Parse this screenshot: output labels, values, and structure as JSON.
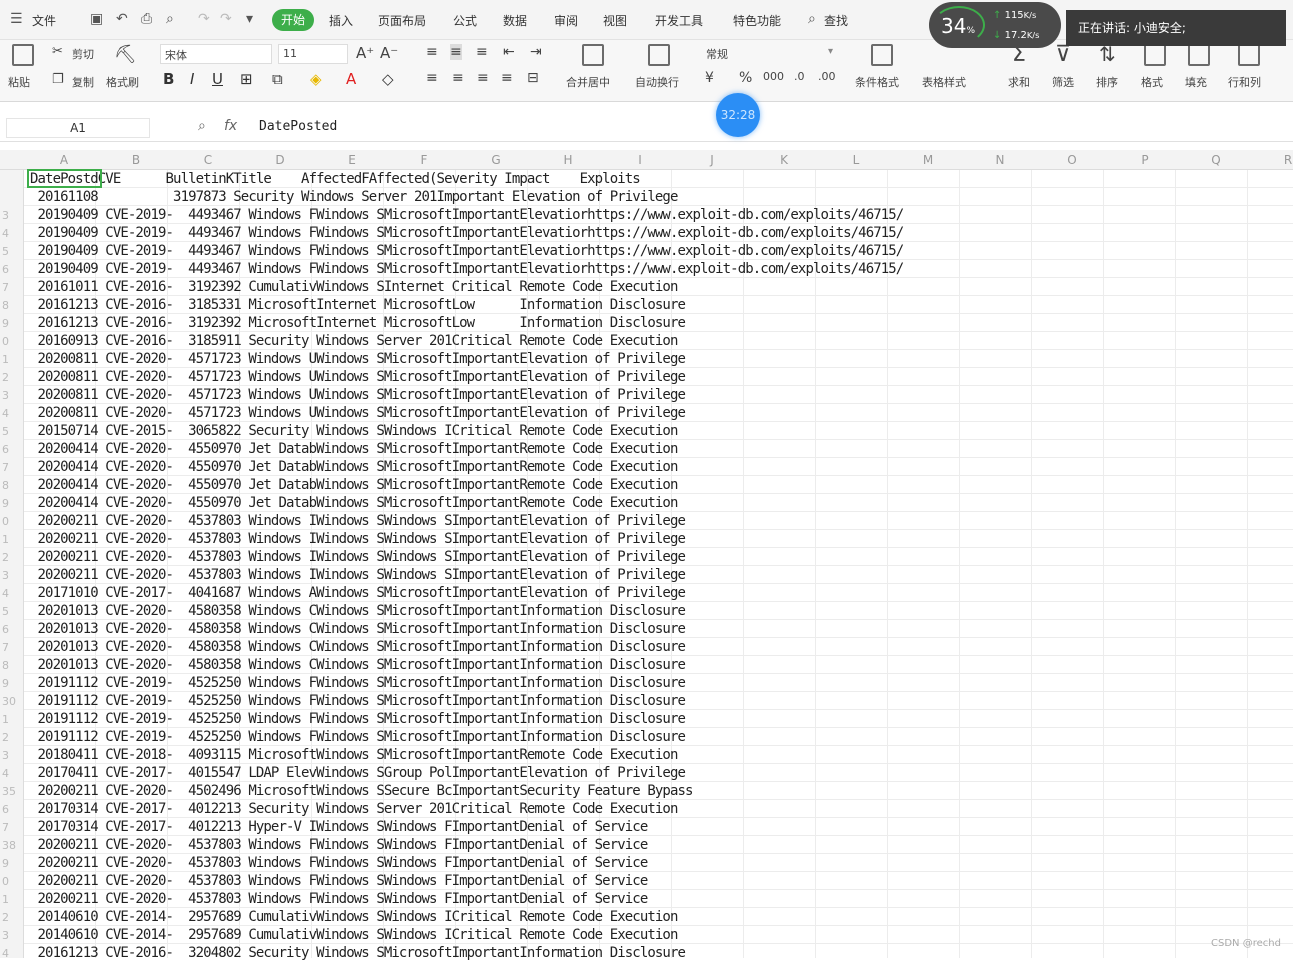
{
  "menubar": {
    "file": "文件",
    "tabs": [
      "开始",
      "插入",
      "页面布局",
      "公式",
      "数据",
      "审阅",
      "视图",
      "开发工具",
      "特色功能"
    ],
    "search": "查找"
  },
  "ribbon": {
    "paste": "粘贴",
    "cut": "剪切",
    "copy": "复制",
    "format_painter": "格式刷",
    "font_name": "宋体",
    "font_size": "11",
    "merge_center": "合并居中",
    "wrap": "自动换行",
    "number_format": "常规",
    "conditional_format": "条件格式",
    "table_style": "表格样式",
    "sum": "求和",
    "filter": "筛选",
    "sort": "排序",
    "format": "格式",
    "fill": "填充",
    "row_col": "行和列"
  },
  "overlay": {
    "cpu_pct": "34",
    "up_speed": "115",
    "down_speed": "17.2",
    "speaking": "正在讲话: 小迪安全;",
    "timer": "32:28"
  },
  "formula_bar": {
    "name_box": "A1",
    "content": "DatePosted"
  },
  "columns": [
    "A",
    "B",
    "C",
    "D",
    "E",
    "F",
    "G",
    "H",
    "I",
    "J",
    "K",
    "L",
    "M",
    "N",
    "O",
    "P",
    "Q",
    "R"
  ],
  "rows": [
    {
      "n": "",
      "text": "DatePostdCVE      BulletinKTitle    AffectedFAffected(Severity Impact    Exploits"
    },
    {
      "n": "",
      "text": " 20161108          3197873 Security Windows Server 201Important Elevation of Privilege"
    },
    {
      "n": "3",
      "text": " 20190409 CVE-2019-  4493467 Windows FWindows SMicrosoftImportantElevatiorhttps://www.exploit-db.com/exploits/46715/"
    },
    {
      "n": "4",
      "text": " 20190409 CVE-2019-  4493467 Windows FWindows SMicrosoftImportantElevatiorhttps://www.exploit-db.com/exploits/46715/"
    },
    {
      "n": "5",
      "text": " 20190409 CVE-2019-  4493467 Windows FWindows SMicrosoftImportantElevatiorhttps://www.exploit-db.com/exploits/46715/"
    },
    {
      "n": "6",
      "text": " 20190409 CVE-2019-  4493467 Windows FWindows SMicrosoftImportantElevatiorhttps://www.exploit-db.com/exploits/46715/"
    },
    {
      "n": "7",
      "text": " 20161011 CVE-2016-  3192392 CumulativWindows SInternet Critical Remote Code Execution"
    },
    {
      "n": "8",
      "text": " 20161213 CVE-2016-  3185331 MicrosoftInternet MicrosoftLow      Information Disclosure"
    },
    {
      "n": "9",
      "text": " 20161213 CVE-2016-  3192392 MicrosoftInternet MicrosoftLow      Information Disclosure"
    },
    {
      "n": "0",
      "text": " 20160913 CVE-2016-  3185911 Security Windows Server 201Critical Remote Code Execution"
    },
    {
      "n": "1",
      "text": " 20200811 CVE-2020-  4571723 Windows UWindows SMicrosoftImportantElevation of Privilege"
    },
    {
      "n": "2",
      "text": " 20200811 CVE-2020-  4571723 Windows UWindows SMicrosoftImportantElevation of Privilege"
    },
    {
      "n": "3",
      "text": " 20200811 CVE-2020-  4571723 Windows UWindows SMicrosoftImportantElevation of Privilege"
    },
    {
      "n": "4",
      "text": " 20200811 CVE-2020-  4571723 Windows UWindows SMicrosoftImportantElevation of Privilege"
    },
    {
      "n": "5",
      "text": " 20150714 CVE-2015-  3065822 Security Windows SWindows ICritical Remote Code Execution"
    },
    {
      "n": "6",
      "text": " 20200414 CVE-2020-  4550970 Jet DatabWindows SMicrosoftImportantRemote Code Execution"
    },
    {
      "n": "7",
      "text": " 20200414 CVE-2020-  4550970 Jet DatabWindows SMicrosoftImportantRemote Code Execution"
    },
    {
      "n": "8",
      "text": " 20200414 CVE-2020-  4550970 Jet DatabWindows SMicrosoftImportantRemote Code Execution"
    },
    {
      "n": "9",
      "text": " 20200414 CVE-2020-  4550970 Jet DatabWindows SMicrosoftImportantRemote Code Execution"
    },
    {
      "n": "0",
      "text": " 20200211 CVE-2020-  4537803 Windows IWindows SWindows SImportantElevation of Privilege"
    },
    {
      "n": "1",
      "text": " 20200211 CVE-2020-  4537803 Windows IWindows SWindows SImportantElevation of Privilege"
    },
    {
      "n": "2",
      "text": " 20200211 CVE-2020-  4537803 Windows IWindows SWindows SImportantElevation of Privilege"
    },
    {
      "n": "3",
      "text": " 20200211 CVE-2020-  4537803 Windows IWindows SWindows SImportantElevation of Privilege"
    },
    {
      "n": "4",
      "text": " 20171010 CVE-2017-  4041687 Windows AWindows SMicrosoftImportantElevation of Privilege"
    },
    {
      "n": "5",
      "text": " 20201013 CVE-2020-  4580358 Windows CWindows SMicrosoftImportantInformation Disclosure"
    },
    {
      "n": "6",
      "text": " 20201013 CVE-2020-  4580358 Windows CWindows SMicrosoftImportantInformation Disclosure"
    },
    {
      "n": "7",
      "text": " 20201013 CVE-2020-  4580358 Windows CWindows SMicrosoftImportantInformation Disclosure"
    },
    {
      "n": "8",
      "text": " 20201013 CVE-2020-  4580358 Windows CWindows SMicrosoftImportantInformation Disclosure"
    },
    {
      "n": "9",
      "text": " 20191112 CVE-2019-  4525250 Windows FWindows SMicrosoftImportantInformation Disclosure"
    },
    {
      "n": "30",
      "text": " 20191112 CVE-2019-  4525250 Windows FWindows SMicrosoftImportantInformation Disclosure"
    },
    {
      "n": "1",
      "text": " 20191112 CVE-2019-  4525250 Windows FWindows SMicrosoftImportantInformation Disclosure"
    },
    {
      "n": "2",
      "text": " 20191112 CVE-2019-  4525250 Windows FWindows SMicrosoftImportantInformation Disclosure"
    },
    {
      "n": "3",
      "text": " 20180411 CVE-2018-  4093115 MicrosoftWindows SMicrosoftImportantRemote Code Execution"
    },
    {
      "n": "4",
      "text": " 20170411 CVE-2017-  4015547 LDAP ElevWindows SGroup PolImportantElevation of Privilege"
    },
    {
      "n": "35",
      "text": " 20200211 CVE-2020-  4502496 MicrosoftWindows SSecure BcImportantSecurity Feature Bypass"
    },
    {
      "n": "6",
      "text": " 20170314 CVE-2017-  4012213 Security Windows Server 201Critical Remote Code Execution"
    },
    {
      "n": "7",
      "text": " 20170314 CVE-2017-  4012213 Hyper-V IWindows SWindows FImportantDenial of Service"
    },
    {
      "n": "38",
      "text": " 20200211 CVE-2020-  4537803 Windows FWindows SWindows FImportantDenial of Service"
    },
    {
      "n": "9",
      "text": " 20200211 CVE-2020-  4537803 Windows FWindows SWindows FImportantDenial of Service"
    },
    {
      "n": "0",
      "text": " 20200211 CVE-2020-  4537803 Windows FWindows SWindows FImportantDenial of Service"
    },
    {
      "n": "1",
      "text": " 20200211 CVE-2020-  4537803 Windows FWindows SWindows FImportantDenial of Service"
    },
    {
      "n": "2",
      "text": " 20140610 CVE-2014-  2957689 CumulativWindows SWindows ICritical Remote Code Execution"
    },
    {
      "n": "3",
      "text": " 20140610 CVE-2014-  2957689 CumulativWindows SWindows ICritical Remote Code Execution"
    },
    {
      "n": "4",
      "text": " 20161213 CVE-2016-  3204802 Security Windows SMicrosoftImportantInformation Disclosure"
    }
  ],
  "watermark": "CSDN @rechd"
}
